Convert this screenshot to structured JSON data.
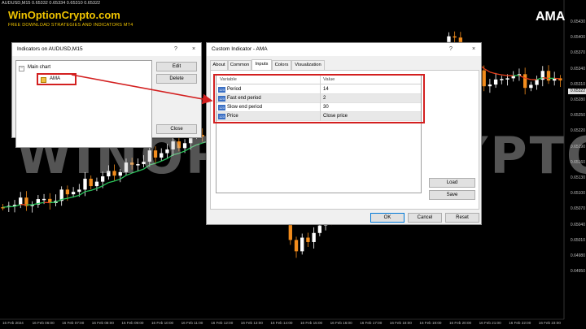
{
  "chart": {
    "symbol_line": "AUDUSD,M15  0.65332 0.65334 0.65310 0.65322",
    "brand": "WinOptionCrypto.com",
    "tagline": "FREE DOWNLOAD STRATEGIES AND INDICATORS MT4",
    "indicator_title": "AMA",
    "watermark": "WINOPTIONCRYPTO.COM",
    "current_price": "0.65322",
    "price_labels": [
      "0.65430",
      "0.65400",
      "0.65370",
      "0.65340",
      "0.65310",
      "0.65280",
      "0.65250",
      "0.65220",
      "0.65190",
      "0.65160",
      "0.65130",
      "0.65100",
      "0.65070",
      "0.65040",
      "0.65010",
      "0.64980",
      "0.64950"
    ],
    "time_labels": [
      "16 Feb 2024",
      "16 Feb 06:00",
      "16 Feb 07:00",
      "16 Feb 08:00",
      "16 Feb 09:00",
      "16 Feb 10:00",
      "16 Feb 11:00",
      "16 Feb 12:00",
      "16 Feb 13:00",
      "16 Feb 14:00",
      "16 Feb 15:00",
      "16 Feb 16:00",
      "16 Feb 17:00",
      "16 Feb 18:00",
      "16 Feb 19:00",
      "16 Feb 20:00",
      "16 Feb 21:00",
      "16 Feb 22:00",
      "16 Feb 23:00"
    ],
    "colors": {
      "bull": "#ffffff",
      "bear": "#f28c1c",
      "ama_up": "#29c25a",
      "ama_down": "#e8401c",
      "brand": "#f0c400"
    }
  },
  "indicators_window": {
    "title": "Indicators on AUDUSD,M15",
    "help_glyph": "?",
    "close_glyph": "×",
    "expander": "−",
    "tree_root": "Main chart",
    "tree_item": "AMA",
    "buttons": {
      "edit": "Edit",
      "delete": "Delete",
      "close": "Close"
    }
  },
  "custom_dialog": {
    "title": "Custom Indicator - AMA",
    "help_glyph": "?",
    "close_glyph": "×",
    "tabs": [
      "About",
      "Common",
      "Inputs",
      "Colors",
      "Visualization"
    ],
    "active_tab": "Inputs",
    "columns": {
      "variable": "Variable",
      "value": "Value"
    },
    "row_icon": "123",
    "params": [
      {
        "variable": "Period",
        "value": "14"
      },
      {
        "variable": "Fast end period",
        "value": "2"
      },
      {
        "variable": "Slow end period",
        "value": "30"
      },
      {
        "variable": "Price",
        "value": "Close price"
      }
    ],
    "buttons": {
      "load": "Load",
      "save": "Save",
      "ok": "OK",
      "cancel": "Cancel",
      "reset": "Reset"
    }
  }
}
